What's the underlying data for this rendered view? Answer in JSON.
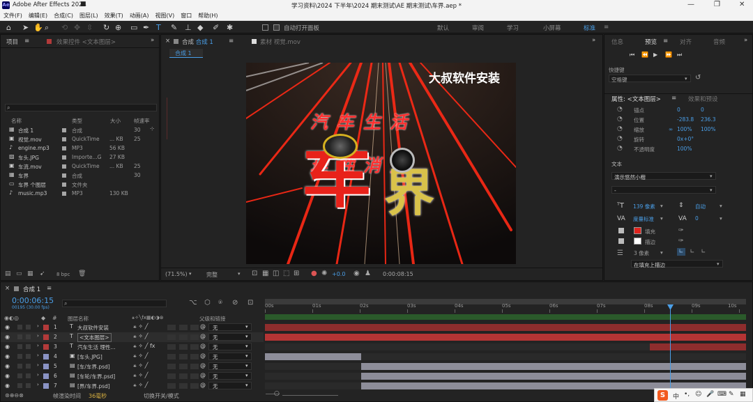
{
  "window": {
    "app_name": "Adobe After Effects 2024",
    "title": "学习资料\\2024 下半年\\2024 期末测试\\AE 期末测试\\车界.aep *"
  },
  "menu": [
    "文件(F)",
    "编辑(E)",
    "合成(C)",
    "图层(L)",
    "效果(T)",
    "动画(A)",
    "视图(V)",
    "窗口",
    "帮助(H)"
  ],
  "toolbar": {
    "auto_open_label": "自动打开面板",
    "workspaces": [
      "默认",
      "审阅",
      "学习",
      "小屏幕",
      "标准"
    ]
  },
  "project": {
    "tab": "项目",
    "effects_tab": "效果控件 <文本图层>",
    "columns": [
      "名称",
      "类型",
      "大小",
      "帧速率"
    ],
    "items": [
      {
        "name": "合成 1",
        "type": "合成",
        "size": "",
        "fps": "30"
      },
      {
        "name": "视觉.mov",
        "type": "QuickTime",
        "size": "... KB",
        "fps": "25"
      },
      {
        "name": "engine.mp3",
        "type": "MP3",
        "size": "56 KB",
        "fps": ""
      },
      {
        "name": "车头.JPG",
        "type": "Importe...G",
        "size": "27 KB",
        "fps": ""
      },
      {
        "name": "车流.mov",
        "type": "QuickTime",
        "size": "... KB",
        "fps": "25"
      },
      {
        "name": "车界",
        "type": "合成",
        "size": "",
        "fps": "30"
      },
      {
        "name": "车界 个图层",
        "type": "文件夹",
        "size": "",
        "fps": ""
      },
      {
        "name": "music.mp3",
        "type": "MP3",
        "size": "130 KB",
        "fps": ""
      }
    ],
    "bpc": "8 bpc"
  },
  "viewer": {
    "tab_comp": "合成",
    "tab_comp_name": "合成 1",
    "tab_footage": "素材 视觉.mov",
    "sub_tab": "合成 1",
    "zoom": "(71.5%)",
    "quality": "完整",
    "exposure": "+0.0",
    "timecode": "0:00:08:15",
    "frame": {
      "corner_text": "大叔软件安装",
      "line1": "汽车生活",
      "line2": "理性消费",
      "big1": "车",
      "big2": "界"
    }
  },
  "right": {
    "tabs": [
      "信息",
      "预览",
      "对齐",
      "音频"
    ],
    "shortcut_label": "快捷键",
    "shortcut_value": "空格键",
    "properties_tab": "属性: <文本图层>",
    "effects_presets_tab": "效果和预设",
    "transform": [
      {
        "label": "锚点",
        "v1": "0",
        "v2": "0"
      },
      {
        "label": "位置",
        "v1": "-283.8",
        "v2": "236.3"
      },
      {
        "label": "缩放",
        "v1": "100%",
        "v2": "100%"
      },
      {
        "label": "旋转",
        "v1": "0x+0°",
        "v2": ""
      },
      {
        "label": "不透明度",
        "v1": "100%",
        "v2": ""
      }
    ],
    "text_heading": "文本",
    "font": "演示悠然小楷",
    "font_style": "-",
    "font_size": "139 像素",
    "leading": "自动",
    "kerning": "度量标准",
    "tracking": "0",
    "fill_label": "填充",
    "stroke_label": "描边",
    "stroke_width": "3 像素",
    "stroke_mode": "在填充上描边",
    "fill_color": "#e0241e",
    "stroke_color": "#ffffff"
  },
  "timeline": {
    "tab": "合成 1",
    "timecode": "0:00:06:15",
    "timecode_sub": "00195 (30.00 fps)",
    "col_source": "图层名称",
    "col_parent": "父级和链接",
    "ruler": [
      "00s",
      "01s",
      "02s",
      "03s",
      "04s",
      "05s",
      "06s",
      "07s",
      "08s",
      "09s",
      "10s"
    ],
    "layers": [
      {
        "num": "1",
        "type": "T",
        "name": "大叔软件安装",
        "parent": "无",
        "color": "#b23a3a",
        "fx": false
      },
      {
        "num": "2",
        "type": "T",
        "name": "<文本图层>",
        "parent": "无",
        "color": "#b23a3a",
        "fx": false
      },
      {
        "num": "3",
        "type": "T",
        "name": "汽车生活 理性...",
        "parent": "无",
        "color": "#b23a3a",
        "fx": true
      },
      {
        "num": "4",
        "type": "img",
        "name": "[车头.JPG]",
        "parent": "无",
        "color": "#8a93c4",
        "fx": false
      },
      {
        "num": "5",
        "type": "psd",
        "name": "[车/车界.psd]",
        "parent": "无",
        "color": "#8a93c4",
        "fx": false
      },
      {
        "num": "6",
        "type": "psd",
        "name": "[车轮/车界.psd]",
        "parent": "无",
        "color": "#8a93c4",
        "fx": false
      },
      {
        "num": "7",
        "type": "psd",
        "name": "[界/车界.psd]",
        "parent": "无",
        "color": "#8a93c4",
        "fx": false
      }
    ],
    "render_time_label": "帧渲染时间",
    "render_time_value": "36毫秒",
    "toggle_label": "切换开关/模式"
  },
  "ime": {
    "lang": "中"
  }
}
